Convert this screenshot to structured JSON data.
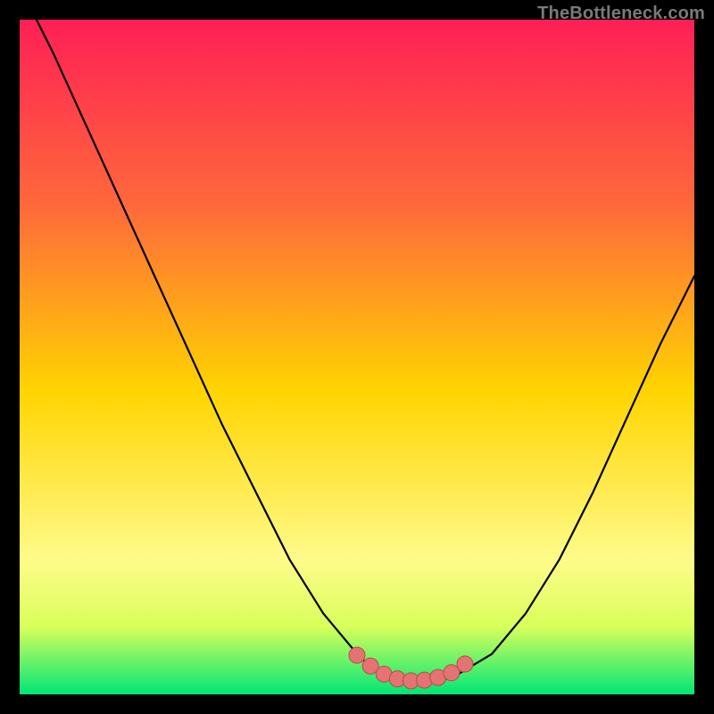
{
  "watermark": "TheBottleneck.com",
  "colors": {
    "frame": "#000000",
    "gradient_top": "#ff1f56",
    "gradient_mid_upper": "#ff6a3a",
    "gradient_mid": "#ffd400",
    "gradient_mid_lower": "#fffb8a",
    "gradient_band": "#d8ff5a",
    "gradient_bottom": "#00e676",
    "curve": "#000000",
    "marker_fill": "#e57373",
    "marker_stroke": "#b84a4a"
  },
  "chart_data": {
    "type": "line",
    "title": "",
    "xlabel": "",
    "ylabel": "",
    "xlim": [
      0,
      100
    ],
    "ylim": [
      0,
      100
    ],
    "series": [
      {
        "name": "bottleneck-curve",
        "x": [
          0,
          5,
          10,
          15,
          20,
          25,
          30,
          35,
          40,
          45,
          50,
          52,
          55,
          58,
          60,
          63,
          65,
          70,
          75,
          80,
          85,
          90,
          95,
          100
        ],
        "y": [
          105,
          95,
          84,
          73,
          62,
          51,
          40,
          30,
          20,
          12,
          6,
          4,
          2.5,
          2,
          2,
          2.2,
          3,
          6,
          12,
          20,
          30,
          41,
          52,
          62
        ]
      }
    ],
    "markers": {
      "name": "highlight-points",
      "x": [
        50,
        52,
        54,
        56,
        58,
        60,
        62,
        64,
        66
      ],
      "y": [
        5.8,
        4.2,
        3.0,
        2.3,
        2.0,
        2.1,
        2.5,
        3.2,
        4.5
      ]
    }
  }
}
